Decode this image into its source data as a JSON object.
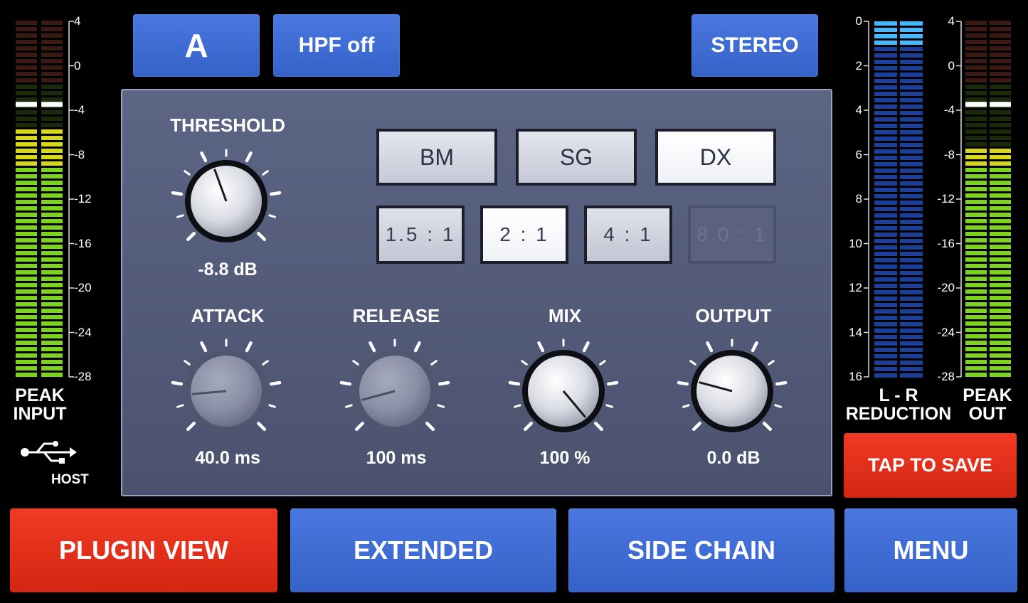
{
  "top": {
    "preset_label": "A",
    "hpf_label": "HPF off",
    "stereo_label": "STEREO"
  },
  "input_meter": {
    "label_line1": "PEAK",
    "label_line2": "INPUT",
    "scale": [
      "4",
      "0",
      "-4",
      "-8",
      "-12",
      "-16",
      "-20",
      "-24",
      "-28"
    ],
    "level_db": -6,
    "peak_db": -3.5,
    "usb_label": "HOST"
  },
  "output_meter": {
    "label_line1": "PEAK",
    "label_line2": "OUT",
    "scale": [
      "4",
      "0",
      "-4",
      "-8",
      "-12",
      "-16",
      "-20",
      "-24",
      "-28"
    ],
    "level_db": -7.5,
    "peak_db": -3.5
  },
  "reduction_meter": {
    "label_line1": "L - R",
    "label_line2": "REDUCTION",
    "scale": [
      "0",
      "2",
      "4",
      "6",
      "8",
      "10",
      "12",
      "14",
      "16"
    ],
    "reduction_db": 1
  },
  "modes": [
    {
      "label": "BM",
      "active": false
    },
    {
      "label": "SG",
      "active": false
    },
    {
      "label": "DX",
      "active": true
    }
  ],
  "ratios": [
    {
      "label": "1.5 : 1",
      "state": "normal"
    },
    {
      "label": "2 : 1",
      "state": "active"
    },
    {
      "label": "4 : 1",
      "state": "normal"
    },
    {
      "label": "8.0 : 1",
      "state": "disabled"
    }
  ],
  "knobs": {
    "threshold": {
      "label": "THRESHOLD",
      "value": "-8.8 dB"
    },
    "attack": {
      "label": "ATTACK",
      "value": "40.0 ms"
    },
    "release": {
      "label": "RELEASE",
      "value": "100 ms"
    },
    "mix": {
      "label": "MIX",
      "value": "100 %"
    },
    "output": {
      "label": "OUTPUT",
      "value": "0.0 dB"
    }
  },
  "save_label": "TAP TO SAVE",
  "bottom_tabs": [
    {
      "label": "PLUGIN VIEW",
      "active": true
    },
    {
      "label": "EXTENDED",
      "active": false
    },
    {
      "label": "SIDE CHAIN",
      "active": false
    },
    {
      "label": "MENU",
      "active": false
    }
  ],
  "colors": {
    "accent_blue": "#3f6ed6",
    "accent_red": "#e2301b",
    "panel": "#535b78",
    "meter_green": "#7ed321",
    "meter_yellow": "#d8d81a",
    "meter_blue": "#1c3f9a"
  }
}
